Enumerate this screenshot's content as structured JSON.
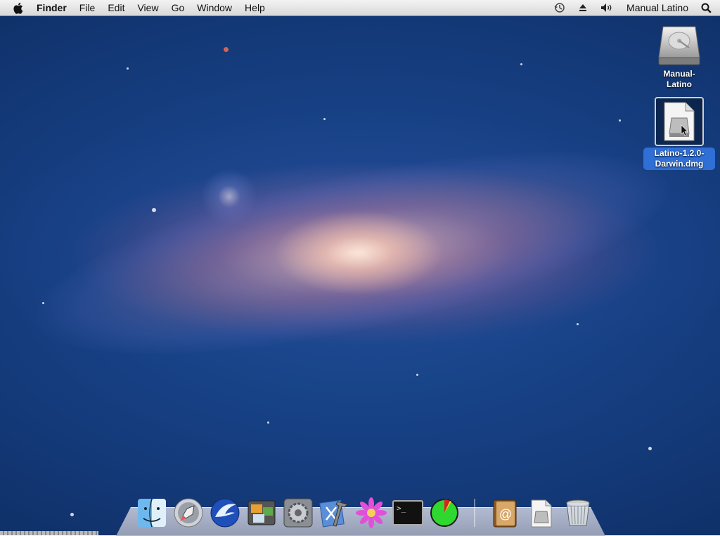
{
  "menubar": {
    "apple_icon": "apple-icon",
    "app_name": "Finder",
    "menus": [
      "File",
      "Edit",
      "View",
      "Go",
      "Window",
      "Help"
    ],
    "status_icons": [
      "time-machine-icon",
      "eject-icon",
      "volume-icon"
    ],
    "user_name": "Manual Latino",
    "spotlight_icon": "spotlight-search-icon"
  },
  "desktop": {
    "icons": [
      {
        "label": "Manual-\nLatino",
        "icon": "hard-drive-icon",
        "selected": false
      },
      {
        "label": "Latino-1.2.0-\nDarwin.dmg",
        "icon": "disk-image-file-icon",
        "selected": true
      }
    ]
  },
  "dock": {
    "apps": [
      {
        "name": "Finder",
        "icon": "finder-icon"
      },
      {
        "name": "Launchpad",
        "icon": "launchpad-rocket-icon"
      },
      {
        "name": "SeaMonkey",
        "icon": "seamonkey-icon"
      },
      {
        "name": "Image Capture",
        "icon": "preview-photos-icon"
      },
      {
        "name": "System Preferences",
        "icon": "system-preferences-icon"
      },
      {
        "name": "Xcode",
        "icon": "xcode-icon"
      },
      {
        "name": "Flower App",
        "icon": "flower-icon"
      },
      {
        "name": "Terminal",
        "icon": "terminal-icon"
      },
      {
        "name": "Activity Monitor",
        "icon": "pie-chart-icon"
      }
    ],
    "right": [
      {
        "name": "Contacts",
        "icon": "address-book-icon"
      },
      {
        "name": "Downloads",
        "icon": "downloads-stack-icon"
      },
      {
        "name": "Trash",
        "icon": "trash-icon"
      }
    ]
  },
  "terminal_prompt": ">_"
}
